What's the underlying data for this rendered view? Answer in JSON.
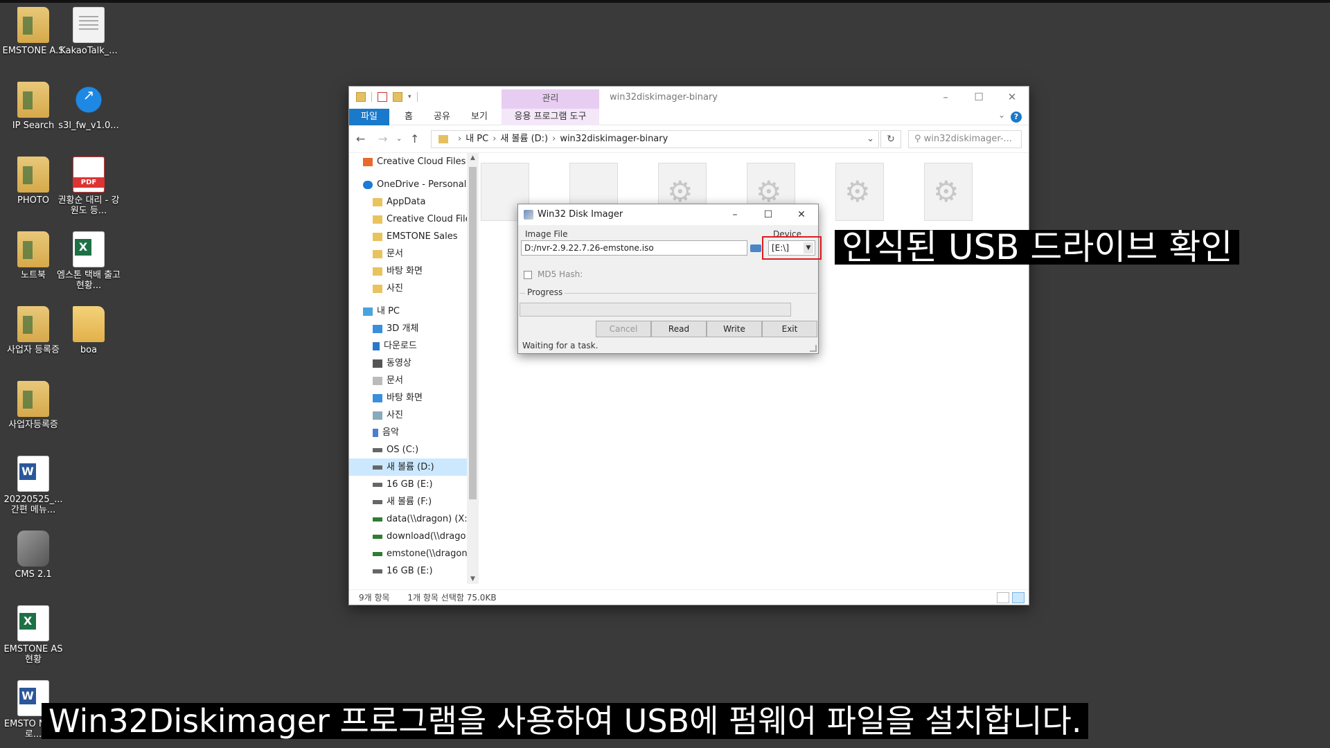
{
  "desktop": {
    "icons": [
      {
        "label": "EMSTONE A.S",
        "kind": "folder"
      },
      {
        "label": "KakaoTalk_...",
        "kind": "doc"
      },
      {
        "label": "IP Search",
        "kind": "folder"
      },
      {
        "label": "s3l_fw_v1.0...",
        "kind": "app"
      },
      {
        "label": "PHOTO",
        "kind": "folder"
      },
      {
        "label": "권황순 대리 - 강원도 등...",
        "kind": "pdf"
      },
      {
        "label": "노트북",
        "kind": "folder"
      },
      {
        "label": "엠스톤 택배 출고 현황...",
        "kind": "xls"
      },
      {
        "label": "사업자 등록증",
        "kind": "folder"
      },
      {
        "label": "boa",
        "kind": "plainfolder"
      },
      {
        "label": "사업자등록증",
        "kind": "folder"
      },
      {
        "label": "20220525_... 간편 메뉴...",
        "kind": "word"
      },
      {
        "label": "CMS 2.1",
        "kind": "cam"
      },
      {
        "label": "EMSTONE AS현황",
        "kind": "xls"
      },
      {
        "label": "EMSTO NVR_로...",
        "kind": "word"
      }
    ],
    "pdf_badge": "PDF",
    "xls_badge": "X",
    "word_badge": "W"
  },
  "explorer": {
    "context_tab": "관리",
    "title": "win32diskimager-binary",
    "ribbon_tabs": [
      "파일",
      "홈",
      "공유",
      "보기",
      "응용 프로그램 도구"
    ],
    "help": "?",
    "address": {
      "crumbs": [
        "내 PC",
        "새 볼륨 (D:)",
        "win32diskimager-binary"
      ]
    },
    "search_placeholder": "win32diskimager-...",
    "nav_items": [
      {
        "label": "Creative Cloud Files",
        "icon": "cc"
      },
      {
        "label": "OneDrive - Personal",
        "icon": "cloud"
      },
      {
        "label": "AppData",
        "icon": "fold"
      },
      {
        "label": "Creative Cloud Files",
        "icon": "fold"
      },
      {
        "label": "EMSTONE Sales",
        "icon": "fold"
      },
      {
        "label": "문서",
        "icon": "fold"
      },
      {
        "label": "바탕 화면",
        "icon": "fold"
      },
      {
        "label": "사진",
        "icon": "fold"
      },
      {
        "label": "내 PC",
        "icon": "pc"
      },
      {
        "label": "3D 개체",
        "icon": "blue"
      },
      {
        "label": "다운로드",
        "icon": "dl"
      },
      {
        "label": "동영상",
        "icon": "vid"
      },
      {
        "label": "문서",
        "icon": "doc"
      },
      {
        "label": "바탕 화면",
        "icon": "blue"
      },
      {
        "label": "사진",
        "icon": "img"
      },
      {
        "label": "음악",
        "icon": "mus"
      },
      {
        "label": "OS (C:)",
        "icon": "drv"
      },
      {
        "label": "새 볼륨 (D:)",
        "icon": "drv"
      },
      {
        "label": "16 GB (E:)",
        "icon": "drv"
      },
      {
        "label": "새 볼륨 (F:)",
        "icon": "drv"
      },
      {
        "label": "data(\\\\dragon) (X:",
        "icon": "net"
      },
      {
        "label": "download(\\\\drago",
        "icon": "net"
      },
      {
        "label": "emstone(\\\\dragon",
        "icon": "net"
      },
      {
        "label": "16 GB (E:)",
        "icon": "drv"
      }
    ],
    "status": {
      "count": "9개 항목",
      "selected": "1개 항목 선택함 75.0KB"
    }
  },
  "imager": {
    "title": "Win32 Disk Imager",
    "image_file_label": "Image File",
    "image_file_value": "D:/nvr-2.9.22.7.26-emstone.iso",
    "device_label": "Device",
    "device_value": "[E:\\]",
    "md5_label": "MD5 Hash:",
    "progress_label": "Progress",
    "buttons": {
      "cancel": "Cancel",
      "read": "Read",
      "write": "Write",
      "exit": "Exit"
    },
    "status": "Waiting for a task."
  },
  "captions": {
    "right": "인식된 USB 드라이브 확인",
    "bottom": "Win32Diskimager 프로그램을 사용하여 USB에 펌웨어 파일을 설치합니다."
  }
}
